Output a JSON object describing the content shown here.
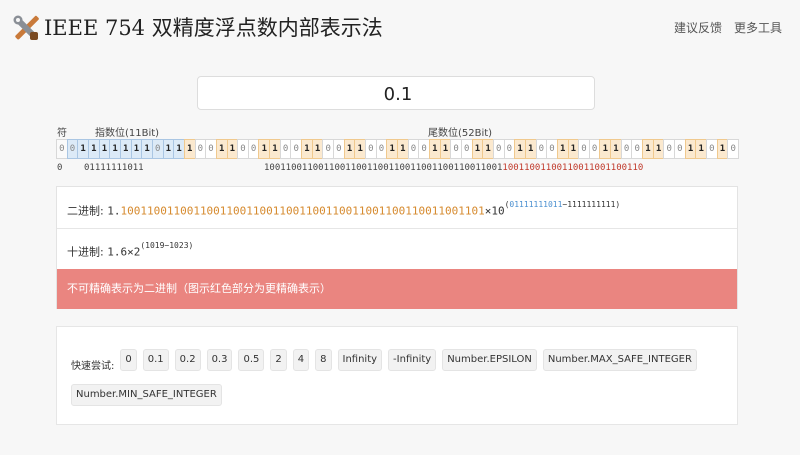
{
  "header": {
    "title": "IEEE 754 双精度浮点数内部表示法",
    "nav": [
      "建议反馈",
      "更多工具"
    ],
    "logo_icon": "tools-icon"
  },
  "input": {
    "value": "0.1"
  },
  "labels": {
    "sign": "符",
    "exponent": "指数位(11Bit)",
    "mantissa": "尾数位(52Bit)"
  },
  "bits": "0011111110111001100110011001100110011001100110011001100110011010",
  "under": {
    "sign": "0",
    "exponent": "01111111011",
    "mantissa_black": "10011001100110011001100110011001100110011001",
    "mantissa_red": "10011001100110011001100110"
  },
  "binary": {
    "label": "二进制:",
    "prefix": "1.",
    "mantissa": "1001100110011001100110011001100110011001100110011001101",
    "times": "×10",
    "exp_blue": "01111111011",
    "exp_rest": "−1111111111)",
    "exp_open": "("
  },
  "decimal": {
    "label": "十进制:",
    "base": "1.6×2",
    "exp": "(1019−1023)"
  },
  "alert": "不可精确表示为二进制（图示红色部分为更精确表示）",
  "quick": {
    "label": "快速尝试:",
    "items": [
      "0",
      "0.1",
      "0.2",
      "0.3",
      "0.5",
      "2",
      "4",
      "8",
      "Infinity",
      "-Infinity",
      "Number.EPSILON",
      "Number.MAX_SAFE_INTEGER",
      "Number.MIN_SAFE_INTEGER"
    ]
  },
  "colors": {
    "exponent_bg": "#dceaf7",
    "mantissa_one_bg": "#fbe9cf",
    "alert_bg": "#ea8580",
    "accent_orange": "#d68a2e",
    "accent_blue": "#4a8fd0",
    "red": "#c0392b"
  }
}
